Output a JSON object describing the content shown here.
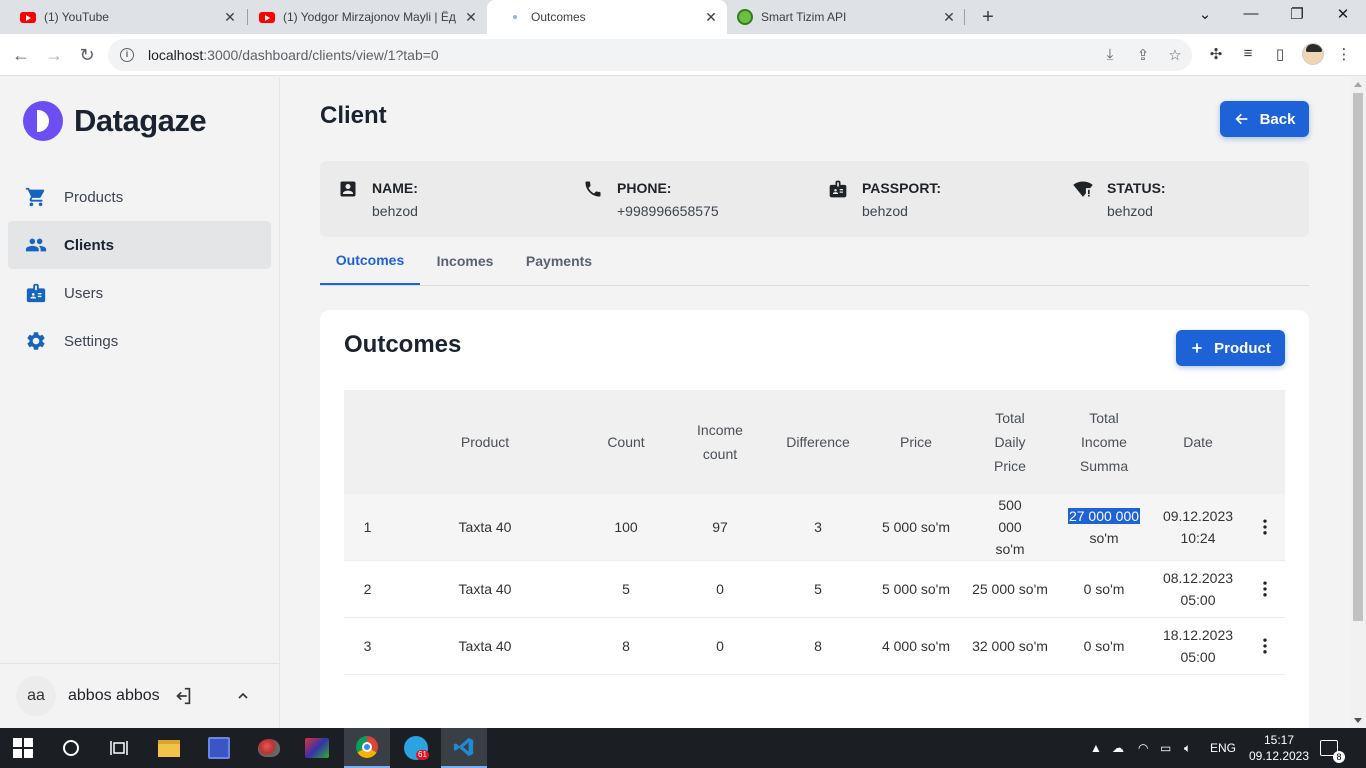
{
  "browser": {
    "tabs": [
      {
        "title": "(1) YouTube",
        "icon": "youtube-icon"
      },
      {
        "title": "(1) Yodgor Mirzajonov Mayli | Ёд",
        "icon": "youtube-icon"
      },
      {
        "title": "Outcomes",
        "icon": "loading-dot-icon"
      },
      {
        "title": "Smart Tizim API",
        "icon": "swagger-icon"
      }
    ],
    "url_host": "localhost",
    "url_path": ":3000/dashboard/clients/view/1?tab=0"
  },
  "sidebar": {
    "brand": "Datagaze",
    "items": [
      {
        "label": "Products",
        "icon": "cart-icon"
      },
      {
        "label": "Clients",
        "icon": "people-icon"
      },
      {
        "label": "Users",
        "icon": "badge-icon"
      },
      {
        "label": "Settings",
        "icon": "gear-icon"
      }
    ],
    "user": {
      "initials": "aa",
      "name": "abbos abbos"
    }
  },
  "page": {
    "title": "Client",
    "back_label": "Back",
    "info": {
      "name_label": "NAME:",
      "name_value": "behzod",
      "phone_label": "PHONE:",
      "phone_value": "+998996658575",
      "passport_label": "PASSPORT:",
      "passport_value": "behzod",
      "status_label": "STATUS:",
      "status_value": "behzod"
    },
    "tabs": [
      "Outcomes",
      "Incomes",
      "Payments"
    ]
  },
  "outcomes": {
    "title": "Outcomes",
    "add_label": "Product",
    "columns": [
      "",
      "Product",
      "Count",
      "Income count",
      "Difference",
      "Price",
      "Total Daily Price",
      "Total Income Summa",
      "Date",
      ""
    ],
    "rows": [
      {
        "n": "1",
        "product": "Taxta 40",
        "count": "100",
        "income_count": "97",
        "difference": "3",
        "price": "5 000 so'm",
        "total_daily": "500 000 so'm",
        "total_income_num": "27 000 000",
        "total_income_unit": "so'm",
        "date": "09.12.2023",
        "time": "10:24"
      },
      {
        "n": "2",
        "product": "Taxta 40",
        "count": "5",
        "income_count": "0",
        "difference": "5",
        "price": "5 000 so'm",
        "total_daily": "25 000 so'm",
        "total_income_num": "0",
        "total_income_unit": "so'm",
        "date": "08.12.2023",
        "time": "05:00"
      },
      {
        "n": "3",
        "product": "Taxta 40",
        "count": "8",
        "income_count": "0",
        "difference": "8",
        "price": "4 000 so'm",
        "total_daily": "32 000 so'm",
        "total_income_num": "0",
        "total_income_unit": "so'm",
        "date": "18.12.2023",
        "time": "05:00"
      }
    ]
  },
  "taskbar": {
    "lang": "ENG",
    "time": "15:17",
    "date": "09.12.2023",
    "telegram_badge": "61",
    "notifications": "8"
  },
  "colors": {
    "accent": "#1d62d6",
    "brand": "#6c4ef2",
    "highlight": "#1d62d6"
  }
}
